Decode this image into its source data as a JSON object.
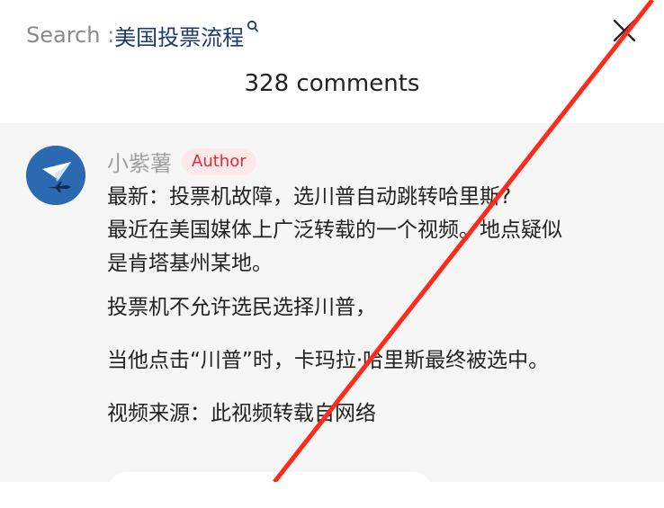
{
  "search": {
    "prefix": "Search : ",
    "keyword": "美国投票流程"
  },
  "header": {
    "comments_count": "328 comments"
  },
  "comment": {
    "author": "小紫薯",
    "badge": "Author",
    "lines": [
      "最新：投票机故障，选川普自动跳转哈里斯?",
      "最近在美国媒体上广泛转载的一个视频。地点疑似",
      "是肯塔基州某地。",
      "投票机不允许选民选择川普，",
      "当他点击“川普”时，卡玛拉·哈里斯最终被选中。",
      "视频来源：此视频转载自网络"
    ]
  },
  "colors": {
    "overlay_line": "#ff2a1a",
    "badge_text": "#e0283e",
    "badge_bg": "#fde8ea",
    "keyword": "#1f3b6e",
    "avatar_bg": "#2b6ab0"
  },
  "icons": [
    "search-icon",
    "close-icon",
    "paper-plane-icon",
    "jet-icon"
  ]
}
